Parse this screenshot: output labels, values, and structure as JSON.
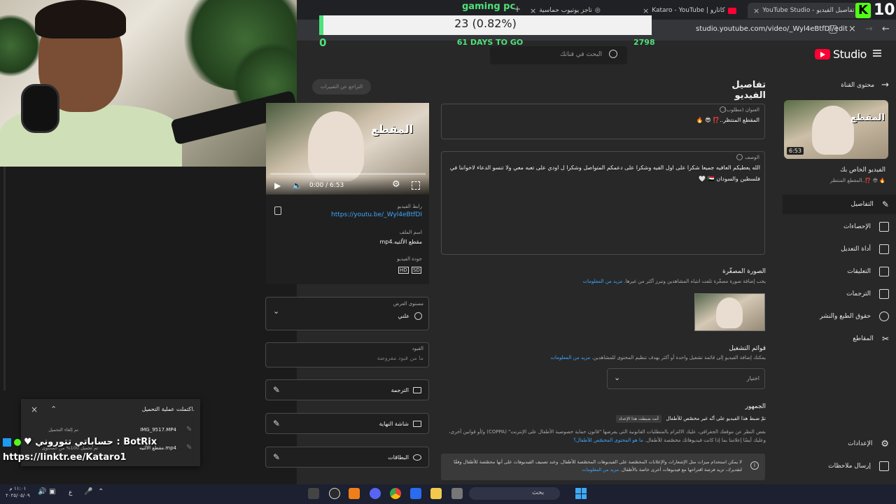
{
  "browser": {
    "tabs": [
      {
        "label": "تفاصيل الفيديو - YouTube Studio",
        "active": true
      },
      {
        "label": "كاتارو | Kataro - YouTube",
        "active": false
      },
      {
        "label": "تاجز يوتيوب حماسية",
        "active": false
      }
    ],
    "new_tab": "+",
    "url": "studio.youtube.com/video/_Wyl4eBtfDI/edit"
  },
  "stream_overlay": {
    "goal_title": "gaming pc",
    "goal_progress_text": "23 (0.82%)",
    "goal_progress_fraction": 0.0082,
    "goal_start": "0",
    "goal_days": "61 DAYS TO GO",
    "goal_target": "2798",
    "kick_count": "10",
    "kick_letter": "K",
    "socials_line": "♥ حساباتي تتوروني : BotRix",
    "socials_name": "BotRix",
    "link": "https://linktr.ee/Kataro1"
  },
  "studio": {
    "logo_text": "Studio",
    "search_placeholder": "البحث في قناتك",
    "page_title": "تفاصيل الفيديو",
    "undo_label": "التراجع عن التغييرات",
    "sidebar": {
      "back_label": "محتوى القناة",
      "thumb_duration": "6:53",
      "your_video_label": "الفيديو الخاص بك",
      "your_video_title": "المقطع المنتظر..⁉️ 😎 🔥",
      "items": [
        {
          "label": "التفاصيل",
          "icon": "pencil-icon",
          "selected": true
        },
        {
          "label": "الإحصاءات",
          "icon": "analytics-icon",
          "selected": false
        },
        {
          "label": "أداة التعديل",
          "icon": "editor-icon",
          "selected": false
        },
        {
          "label": "التعليقات",
          "icon": "comments-icon",
          "selected": false
        },
        {
          "label": "الترجمات",
          "icon": "subtitles-icon",
          "selected": false
        },
        {
          "label": "حقوق الطبع والنشر",
          "icon": "copyright-icon",
          "selected": false
        },
        {
          "label": "المقاطع",
          "icon": "scissors-icon",
          "selected": false
        }
      ],
      "settings_label": "الإعدادات",
      "feedback_label": "إرسال ملاحظات"
    },
    "title_field": {
      "label": "العنوان (مطلوب)",
      "value": "المقطع المنتظر..⁉️ 😎 🔥"
    },
    "description_field": {
      "label": "الوصف",
      "value": "الله يعطيكم العافيه جميعا شكرا على اول الفيه وشكرا على دعمكم المتواصل وشكرا ل اودي على تعبه معي ولا تنسو الدعاء لاخواننا في فلسطين والسودان 🇸🇩 🤍"
    },
    "thumbnail": {
      "heading": "الصورة المصغّرة",
      "text": "يجب إضافة صورة مصغّرة تلفت انتباه المشاهدين وتبرز أكثر من غيرها.",
      "link": "مزيد من المعلومات"
    },
    "playlists": {
      "heading": "قوائم التشغيل",
      "text": "يمكنك إضافة الفيديو إلى قائمة تشغيل واحدة أو أكثر بهدف تنظيم المحتوى للمشاهدين.",
      "link": "مزيد من المعلومات",
      "select": "اختيار"
    },
    "audience": {
      "heading": "الجمهور",
      "line": "تمّ ضبط هذا الفيديو على أنّه غير مخصّص للأطفال",
      "tag": "أنت ضبطت هذا الإعداد",
      "body": "بغض النظر عن موقعك الجغرافي، عليك الالتزام بالمتطلبات القانونية التي يفرضها \"قانون حماية خصوصية الأطفال على الإنترنت\" (COPPA) و/أو قوانين أخرى، وعليك أيضًا إعلامنا بما إذا كانت فيديوهاتك مخصّصة للأطفال.",
      "link": "ما هو المحتوى المخصّص للأطفال؟",
      "notice": "لا يمكن استخدام ميزات مثل الإشعارات والإعلانات المخصّصة على الفيديوهات المخصّصة للأطفال. وعند تصنيف الفيديوهات على أنها مخصّصة للأطفال وفقًا لتقديرك، تزيد فرصة اقتراحها مع فيديوهات أخرى خاصة بالأطفال.",
      "notice_link": "مزيد من المعلومات"
    },
    "preview": {
      "time": "0:00 / 6:53",
      "link_label": "رابط الفيديو",
      "link": "https://youtu.be/_Wyl4eBtfDI",
      "file_label": "اسم الملف",
      "file": "مقطع الألتيه.mp4",
      "quality_label": "جودة الفيديو",
      "quality_hd": "HD",
      "quality_sd": "SD",
      "visibility_label": "مستوى العرض",
      "visibility_value": "علني",
      "restrictions_label": "القيود",
      "restrictions_value": "ما من قيود مفروضة",
      "subtitles_label": "الترجمة",
      "endscreen_label": "شاشة النهاية",
      "cards_label": "البطاقات"
    },
    "thumb_overlay_text": "المقطع"
  },
  "upload_panel": {
    "title": "اكتملت عملية التحميل.",
    "row1_file": "IMG_9517.MP4",
    "row1_status": "تم إلغاء التحميل",
    "row2_file": "مقطع الألتيه.mp4",
    "row2_status": "تم تحميل 100% من المحتوى"
  },
  "taskbar": {
    "search": "بحث",
    "time": "١١:٠١ م",
    "date": "٢٠٢٥/٠٥/٠٩"
  }
}
